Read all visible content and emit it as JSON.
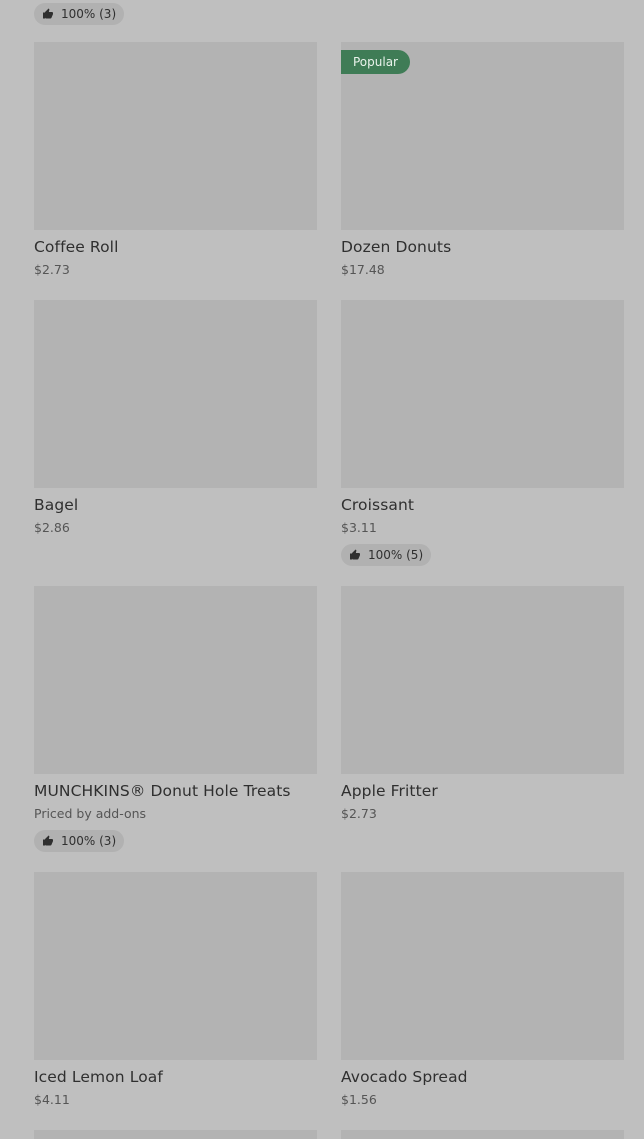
{
  "top_rating": "100% (3)",
  "items": [
    {
      "name": "Coffee Roll",
      "price": "$2.73"
    },
    {
      "name": "Dozen Donuts",
      "price": "$17.48",
      "badge": "Popular"
    },
    {
      "name": "Bagel",
      "price": "$2.86"
    },
    {
      "name": "Croissant",
      "price": "$3.11",
      "rating": "100% (5)"
    },
    {
      "name": "MUNCHKINS® Donut Hole Treats",
      "price": "Priced by add-ons",
      "rating": "100% (3)"
    },
    {
      "name": "Apple Fritter",
      "price": "$2.73"
    },
    {
      "name": "Iced Lemon Loaf",
      "price": "$4.11"
    },
    {
      "name": "Avocado Spread",
      "price": "$1.56"
    }
  ],
  "colors": {
    "background": "#bfbfbf",
    "thumbnail": "#b3b3b3",
    "badge": "#3f7c56"
  },
  "icons": {
    "rating": "thumbs-up-icon"
  }
}
